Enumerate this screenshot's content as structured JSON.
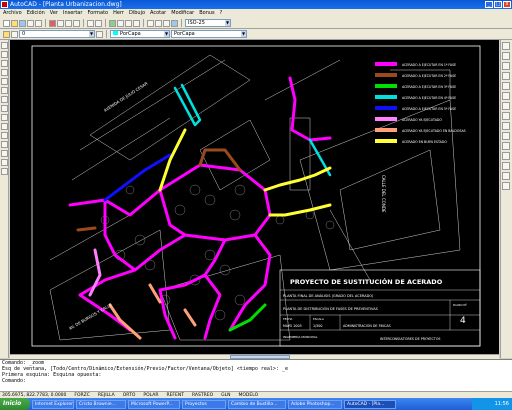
{
  "window": {
    "title": "AutoCAD - [Planta Urbanizacion.dwg]",
    "controls": [
      "_",
      "□",
      "x"
    ]
  },
  "menu": [
    "Archivo",
    "Edición",
    "Ver",
    "Insertar",
    "Formato",
    "Herr",
    "Dibujo",
    "Acotar",
    "Modificar",
    "Bonus",
    "?"
  ],
  "toolbar": {
    "layer_value": "0",
    "color_value": "PorCapa",
    "linetype_value": "PorCapa",
    "standards_value": "ISO-25",
    "color_swatch": "#00ffff"
  },
  "drawing": {
    "legend": [
      {
        "label": "ACERADO A EJECUTAR EN 1ª FASE",
        "color": "#ff00ff"
      },
      {
        "label": "ACERADO A EJECUTAR EN 2ª FASE",
        "color": "#9b4a1e"
      },
      {
        "label": "ACERADO A EJECUTAR EN 3ª FASE",
        "color": "#00e000"
      },
      {
        "label": "ACERADO A EJECUTAR EN 4ª FASE",
        "color": "#00e0e0"
      },
      {
        "label": "ACERADO A EJECUTAR EN 5ª FASE",
        "color": "#1010ff"
      },
      {
        "label": "ACERADO YA EJECUTADO",
        "color": "#ff80ff"
      },
      {
        "label": "ACERADO YA EJECUTADO EN BALDOSAS",
        "color": "#ffa07a"
      },
      {
        "label": "ACERADO EN BUEN ESTADO",
        "color": "#ffff33"
      }
    ],
    "street_labels": [
      "AVENIDA DE JULIO CESAR",
      "CALLE DEL CONDE",
      "AV. DE BURGOS Y CALLE"
    ],
    "title_block": {
      "project": "PROYECTO DE SUSTITUCIÓN DE ACERADO",
      "subtitle": "PLANTA FINAL DE ANÁLISIS (GRADO DEL ACERADO)",
      "plan": "PLANTA DE DISTRIBUCIÓN DE FASES DE PREVENTIVAS",
      "date_label": "FECHA",
      "date": "MAYO 2005",
      "scale_label": "ESCALA",
      "scale": "1/500",
      "plane_label": "PLANO Nº",
      "plane_no": "4",
      "author": "INGENIERÍA MUNICIPAL",
      "author_line": "ADMINISTRACIÓN DE FINCAS",
      "company": "INTERCONSULTORES DE PROYECTOS"
    }
  },
  "command_lines": [
    "Comando: _zoom",
    "Esq de ventana, [Todo/Centro/Dinámico/Extensión/Previo/Factor/Ventana/Objeto] <tiempo real>: _e",
    "Primera esquina: Esquina opuesta:",
    "Comando:"
  ],
  "status": {
    "coords": "305.6975, 822.7783, 0.0000",
    "modes": [
      "FORZC",
      "REJILLA",
      "ORTO",
      "POLAR",
      "REFENT",
      "RASTREO",
      "GLN",
      "MODELO"
    ]
  },
  "taskbar": {
    "start_label": "Inicio",
    "tasks": [
      "Internet Explorer",
      "Cristo Brownie...",
      "Microsoft PowerP...",
      "Proyectos",
      "Cambio de Bustillo...",
      "Adobe Photoshop...",
      "AutoCAD - [Pla..."
    ],
    "active_index": 6,
    "clock": "11:56"
  }
}
